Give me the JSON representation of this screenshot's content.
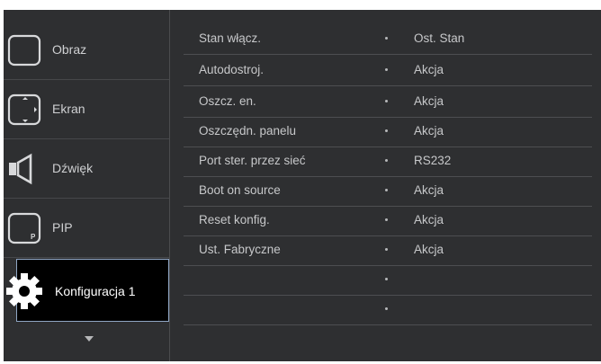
{
  "sidebar": {
    "items": [
      {
        "label": "Obraz",
        "icon": "picture-icon"
      },
      {
        "label": "Ekran",
        "icon": "screen-icon"
      },
      {
        "label": "Dźwięk",
        "icon": "speaker-icon"
      },
      {
        "label": "PIP",
        "icon": "pip-icon"
      },
      {
        "label": "Konfiguracja 1",
        "icon": "gear-icon",
        "selected": true
      }
    ],
    "scroll_indicator": "chevron-down-icon"
  },
  "settings": {
    "rows": [
      {
        "key": "Stan włącz.",
        "value": "Ost. Stan"
      },
      {
        "key": "Autodostroj.",
        "value": "Akcja"
      },
      {
        "key": "Oszcz. en.",
        "value": "Akcja"
      },
      {
        "key": "Oszczędn. panelu",
        "value": "Akcja"
      },
      {
        "key": "Port ster. przez sieć",
        "value": "RS232"
      },
      {
        "key": "Boot on source",
        "value": "Akcja"
      },
      {
        "key": "Reset konfig.",
        "value": "Akcja"
      },
      {
        "key": "Ust. Fabryczne",
        "value": "Akcja"
      },
      {
        "key": "",
        "value": ""
      },
      {
        "key": "",
        "value": ""
      }
    ]
  },
  "colors": {
    "panel_background": "#2e2f31",
    "selected_background": "#000000",
    "selected_border": "#8fa6c4",
    "text": "#c7c8ca"
  }
}
